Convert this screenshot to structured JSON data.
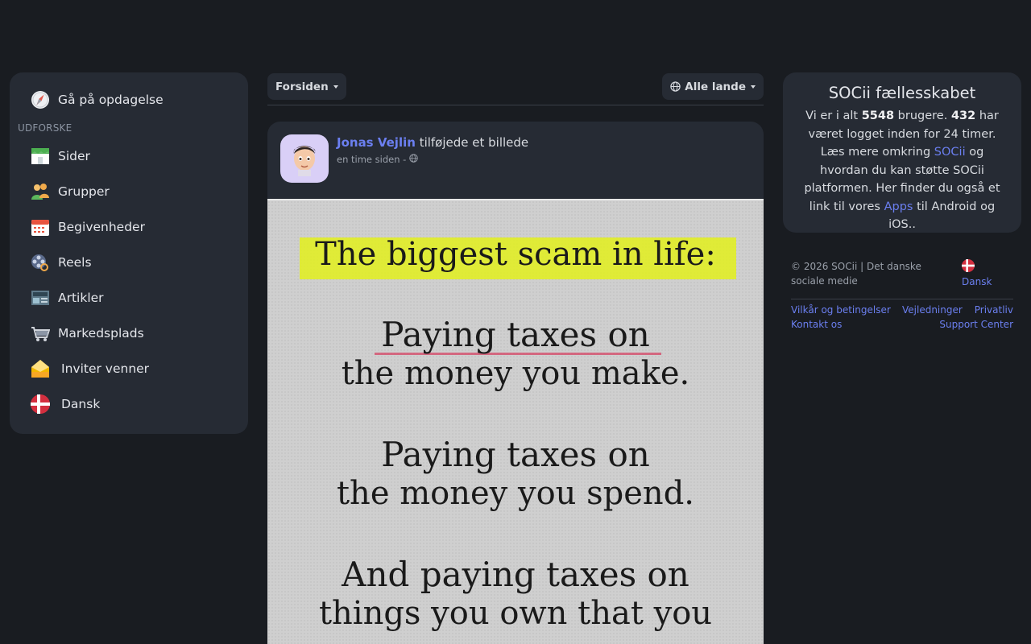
{
  "sidebar": {
    "discover": "Gå på opdagelse",
    "section_label": "UDFORSKE",
    "items": [
      {
        "label": "Sider"
      },
      {
        "label": "Grupper"
      },
      {
        "label": "Begivenheder"
      },
      {
        "label": "Reels"
      },
      {
        "label": "Artikler"
      },
      {
        "label": "Markedsplads"
      },
      {
        "label": "Inviter venner"
      },
      {
        "label": "Dansk"
      }
    ]
  },
  "feed": {
    "filter_label": "Forsiden",
    "country_label": "Alle lande",
    "post": {
      "author": "Jonas Vejlin",
      "action": "tilføjede et billede",
      "time": "en time siden -",
      "image_lines": [
        "The biggest scam in life:",
        "Paying taxes on",
        "the money you make.",
        "Paying taxes on",
        "the money you spend.",
        "And paying taxes on",
        "things you own that you"
      ]
    }
  },
  "community": {
    "title": "SOCii fællesskabet",
    "t1": "Vi er i alt ",
    "users": "5548",
    "t2": " brugere. ",
    "online": "432",
    "t3": " har været logget inden for 24 timer. Læs mere omkring ",
    "link1": "SOCii",
    "t4": " og hvordan du kan støtte SOCii platformen. Her finder du også et link til vores ",
    "link2": "Apps",
    "t5": " til Android og iOS.."
  },
  "footer": {
    "copyright": "© 2026 SOCii | Det danske sociale medie",
    "language": "Dansk",
    "links": [
      "Vilkår og betingelser",
      "Vejledninger",
      "Privatliv",
      "Kontakt os",
      "Support Center"
    ]
  },
  "colors": {
    "background": "#191c21",
    "card": "#262b34",
    "accent": "#6b7ff0",
    "highlight": "#e3f01c"
  }
}
